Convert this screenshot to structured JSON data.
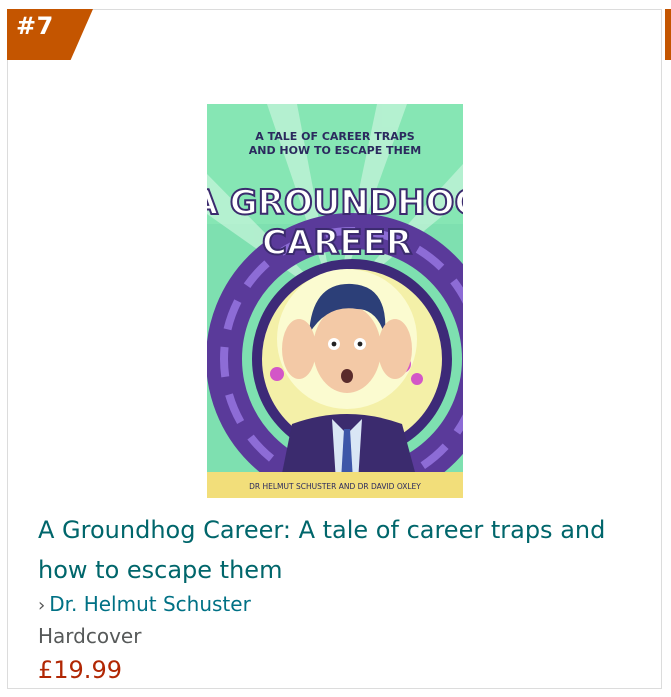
{
  "rank": {
    "label": "#7"
  },
  "product": {
    "cover": {
      "tagline_line1": "A TALE OF CAREER TRAPS",
      "tagline_line2": "AND HOW TO ESCAPE THEM",
      "title_line1": "A GROUNDHOG",
      "title_line2": "CAREER",
      "authors_footer": "DR HELMUT SCHUSTER AND DR DAVID OXLEY"
    },
    "title": "A Groundhog Career: A tale of career traps and how to escape them",
    "author_chevron": "›",
    "author": "Dr. Helmut Schuster",
    "format": "Hardcover",
    "price": "£19.99"
  },
  "colors": {
    "badge": "#c45500",
    "title_link": "#00666b",
    "author_link": "#007185",
    "price": "#b12704",
    "cover_bg": "#7ee0b0",
    "cover_footer": "#f2de7a"
  }
}
